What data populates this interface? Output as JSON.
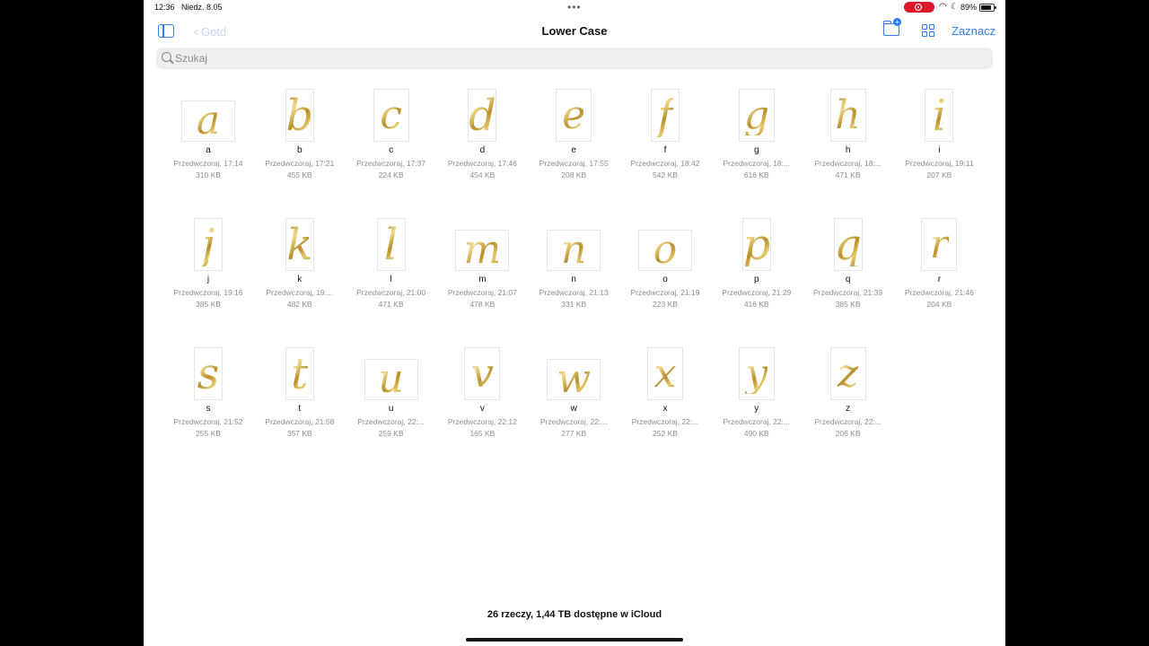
{
  "status": {
    "time": "12:36",
    "date": "Niedz. 8.05",
    "battery": "89%"
  },
  "nav": {
    "back_label": "Gotd",
    "title": "Lower Case",
    "select_label": "Zaznacz"
  },
  "search": {
    "placeholder": "Szukaj"
  },
  "files": [
    {
      "name": "a",
      "modified": "Przedwczoraj, 17:14",
      "size": "310 KB",
      "thumb": "wide"
    },
    {
      "name": "b",
      "modified": "Przedwczoraj, 17:21",
      "size": "455 KB",
      "thumb": "tall"
    },
    {
      "name": "c",
      "modified": "Przedwczoraj, 17:37",
      "size": "224 KB",
      "thumb": "mid"
    },
    {
      "name": "d",
      "modified": "Przedwczoraj, 17:46",
      "size": "454 KB",
      "thumb": "tall"
    },
    {
      "name": "e",
      "modified": "Przedwczoraj, 17:55",
      "size": "208 KB",
      "thumb": "mid"
    },
    {
      "name": "f",
      "modified": "Przedwczoraj, 18:42",
      "size": "542 KB",
      "thumb": "tall"
    },
    {
      "name": "g",
      "modified": "Przedwczoraj, 18:...",
      "size": "616 KB",
      "thumb": "mid"
    },
    {
      "name": "h",
      "modified": "Przedwczoraj, 18:...",
      "size": "471 KB",
      "thumb": "mid"
    },
    {
      "name": "i",
      "modified": "Przedwczoraj, 19:11",
      "size": "207 KB",
      "thumb": "tall"
    },
    {
      "name": "j",
      "modified": "Przedwczoraj, 19:16",
      "size": "385 KB",
      "thumb": "tall"
    },
    {
      "name": "k",
      "modified": "Przedwczoraj, 19:...",
      "size": "482 KB",
      "thumb": "tall"
    },
    {
      "name": "l",
      "modified": "Przedwczoraj, 21:00",
      "size": "471 KB",
      "thumb": "tall"
    },
    {
      "name": "m",
      "modified": "Przedwczoraj, 21:07",
      "size": "478 KB",
      "thumb": "wide"
    },
    {
      "name": "n",
      "modified": "Przedwczoraj, 21:13",
      "size": "331 KB",
      "thumb": "wide"
    },
    {
      "name": "o",
      "modified": "Przedwczoraj, 21:19",
      "size": "223 KB",
      "thumb": "wide"
    },
    {
      "name": "p",
      "modified": "Przedwczoraj, 21:29",
      "size": "416 KB",
      "thumb": "tall"
    },
    {
      "name": "q",
      "modified": "Przedwczoraj, 21:39",
      "size": "385 KB",
      "thumb": "tall"
    },
    {
      "name": "r",
      "modified": "Przedwczoraj, 21:46",
      "size": "204 KB",
      "thumb": "mid"
    },
    {
      "name": "s",
      "modified": "Przedwczoraj, 21:52",
      "size": "255 KB",
      "thumb": "tall"
    },
    {
      "name": "t",
      "modified": "Przedwczoraj, 21:58",
      "size": "357 KB",
      "thumb": "tall"
    },
    {
      "name": "u",
      "modified": "Przedwczoraj, 22:...",
      "size": "259 KB",
      "thumb": "wide"
    },
    {
      "name": "v",
      "modified": "Przedwczoraj, 22:12",
      "size": "165 KB",
      "thumb": "mid"
    },
    {
      "name": "w",
      "modified": "Przedwczoraj, 22:...",
      "size": "277 KB",
      "thumb": "wide"
    },
    {
      "name": "x",
      "modified": "Przedwczoraj, 22:...",
      "size": "252 KB",
      "thumb": "mid"
    },
    {
      "name": "y",
      "modified": "Przedwczoraj, 22:...",
      "size": "490 KB",
      "thumb": "mid"
    },
    {
      "name": "z",
      "modified": "Przedwczoraj, 22:...",
      "size": "206 KB",
      "thumb": "mid"
    }
  ],
  "footer": {
    "summary": "26 rzeczy, 1,44 TB dostępne w iCloud"
  },
  "colors": {
    "accent": "#2f7cf6",
    "record": "#e0162b",
    "gold": "#c7a03a"
  },
  "icons": [
    "sidebar-icon",
    "chevron-left-icon",
    "new-folder-icon",
    "grid-view-icon",
    "search-icon",
    "wifi-icon",
    "moon-icon",
    "battery-icon",
    "record-icon"
  ]
}
